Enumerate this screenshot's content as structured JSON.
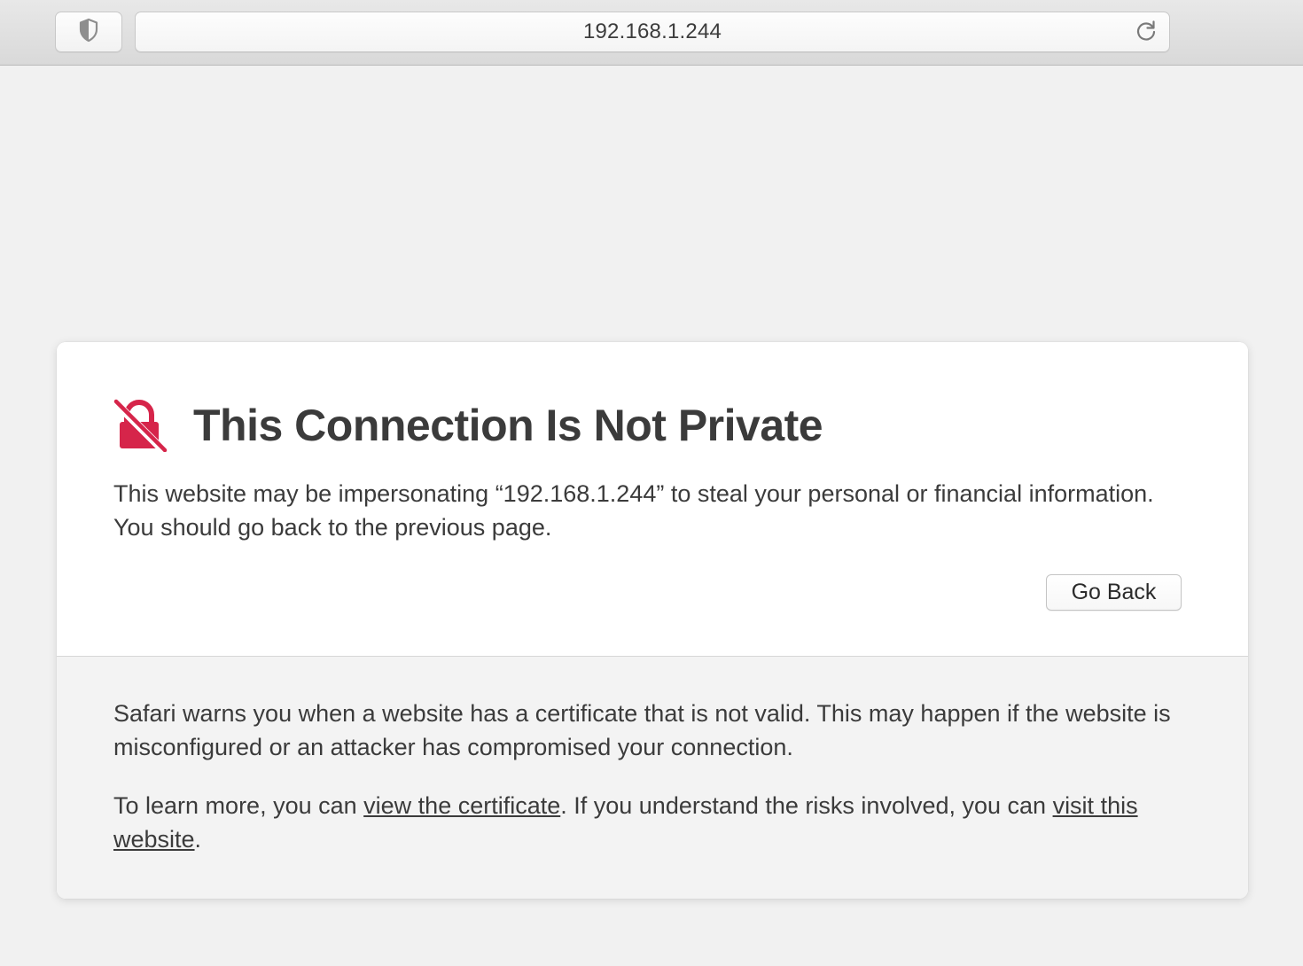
{
  "toolbar": {
    "shield_icon": "shield-half-icon",
    "address": "192.168.1.244",
    "reload_icon": "reload-icon"
  },
  "warning": {
    "icon": "broken-lock-icon",
    "icon_color": "#d6254a",
    "title": "This Connection Is Not Private",
    "description": "This website may be impersonating “192.168.1.244” to steal your personal or financial information. You should go back to the previous page.",
    "go_back_label": "Go Back"
  },
  "details": {
    "explanation": "Safari warns you when a website has a certificate that is not valid. This may happen if the website is misconfigured or an attacker has compromised your connection.",
    "learn_more_prefix": "To learn more, you can ",
    "view_certificate_link": "view the certificate",
    "learn_more_middle": ". If you understand the risks involved, you can ",
    "visit_website_link": "visit this website",
    "learn_more_suffix": "."
  }
}
